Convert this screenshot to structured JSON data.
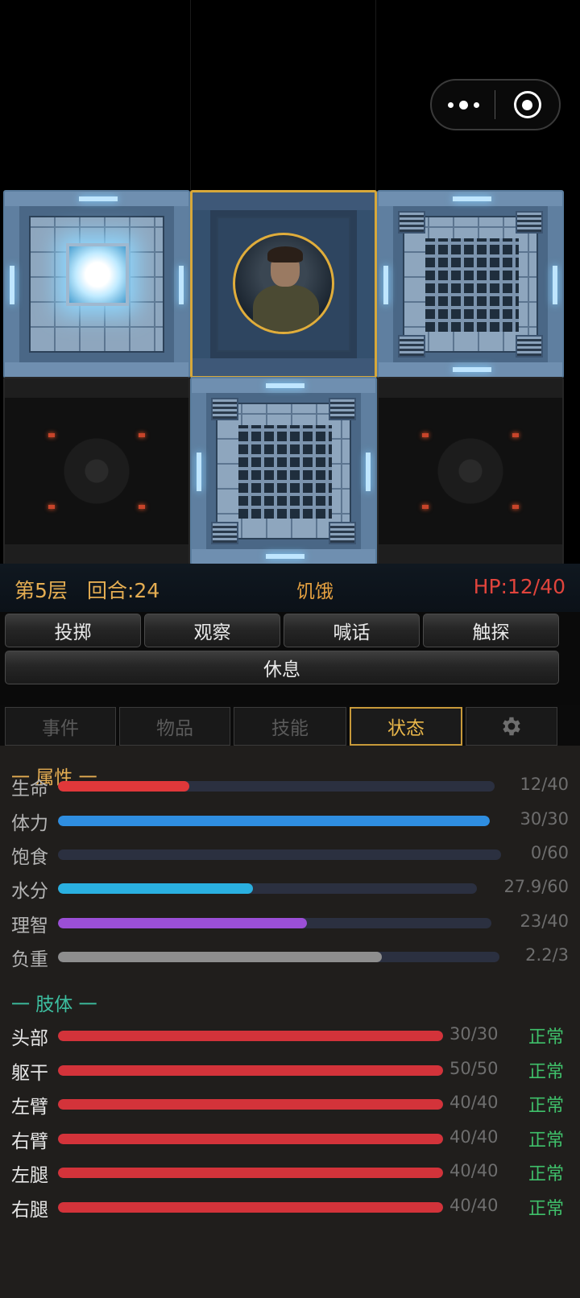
{
  "status_bar": {
    "floor": "第5层",
    "turn": "回合:24",
    "condition": "饥饿",
    "hp": "HP:12/40"
  },
  "actions": {
    "throw": "投掷",
    "observe": "观察",
    "shout": "喊话",
    "probe": "触探",
    "rest": "休息"
  },
  "tabs": {
    "events": "事件",
    "items": "物品",
    "skills": "技能",
    "status": "状态",
    "settings_icon": "gear-icon"
  },
  "attributes": {
    "title": "一 属性 一",
    "title_color": "#e4ad52",
    "rows": [
      {
        "label": "生命",
        "value": "12/40",
        "fraction": 0.3,
        "color": "#e0383a"
      },
      {
        "label": "体力",
        "value": "30/30",
        "fraction": 1.0,
        "color": "#2f8ee0"
      },
      {
        "label": "饱食",
        "value": "0/60",
        "fraction": 0.0,
        "color": "#e0a030"
      },
      {
        "label": "水分",
        "value": "27.9/60",
        "fraction": 0.465,
        "color": "#2ab0e0"
      },
      {
        "label": "理智",
        "value": "23/40",
        "fraction": 0.575,
        "color": "#9b4fd6"
      },
      {
        "label": "负重",
        "value": "2.2/3",
        "fraction": 0.733,
        "color": "#8e8e8e"
      }
    ]
  },
  "limbs": {
    "title": "一 肢体 一",
    "title_color": "#3dbfa0",
    "rows": [
      {
        "label": "头部",
        "value": "30/30",
        "status": "正常",
        "fraction": 1.0
      },
      {
        "label": "躯干",
        "value": "50/50",
        "status": "正常",
        "fraction": 1.0
      },
      {
        "label": "左臂",
        "value": "40/40",
        "status": "正常",
        "fraction": 1.0
      },
      {
        "label": "右臂",
        "value": "40/40",
        "status": "正常",
        "fraction": 1.0
      },
      {
        "label": "左腿",
        "value": "40/40",
        "status": "正常",
        "fraction": 1.0
      },
      {
        "label": "右腿",
        "value": "40/40",
        "status": "正常",
        "fraction": 1.0
      }
    ]
  },
  "colors": {
    "accent": "#e4ad52",
    "hp_red": "#e0443c",
    "ok_green": "#3fc06a",
    "limb_bar": "#d3333a"
  }
}
